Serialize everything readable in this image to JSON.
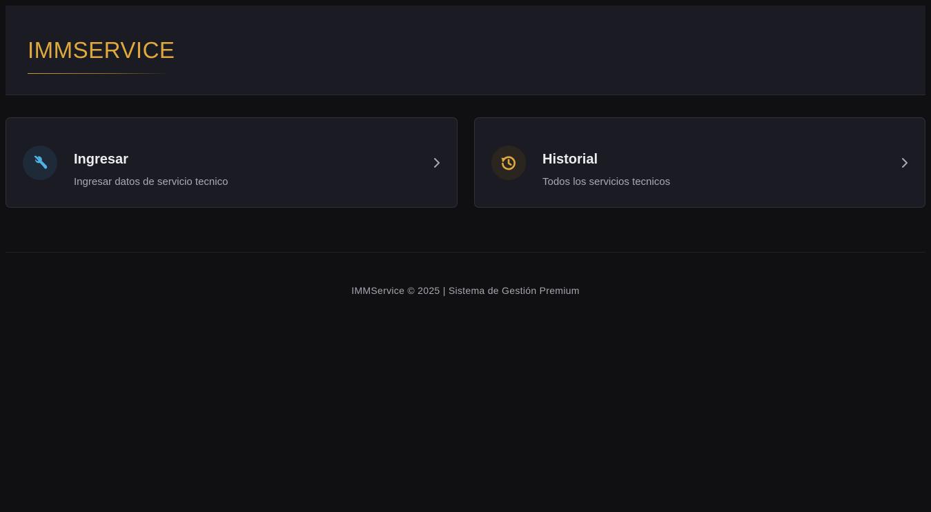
{
  "header": {
    "brand": "IMMSERVICE"
  },
  "cards": [
    {
      "title": "Ingresar",
      "description": "Ingresar datos de servicio tecnico",
      "icon": "tools-icon",
      "accent": "#4fb3e8"
    },
    {
      "title": "Historial",
      "description": "Todos los servicios tecnicos",
      "icon": "history-icon",
      "accent": "#e0a93d"
    }
  ],
  "footer": {
    "text": "IMMService © 2025 | Sistema de Gestión Premium"
  },
  "colors": {
    "background": "#101013",
    "panel": "#1b1b23",
    "brand": "#e0a93d"
  }
}
